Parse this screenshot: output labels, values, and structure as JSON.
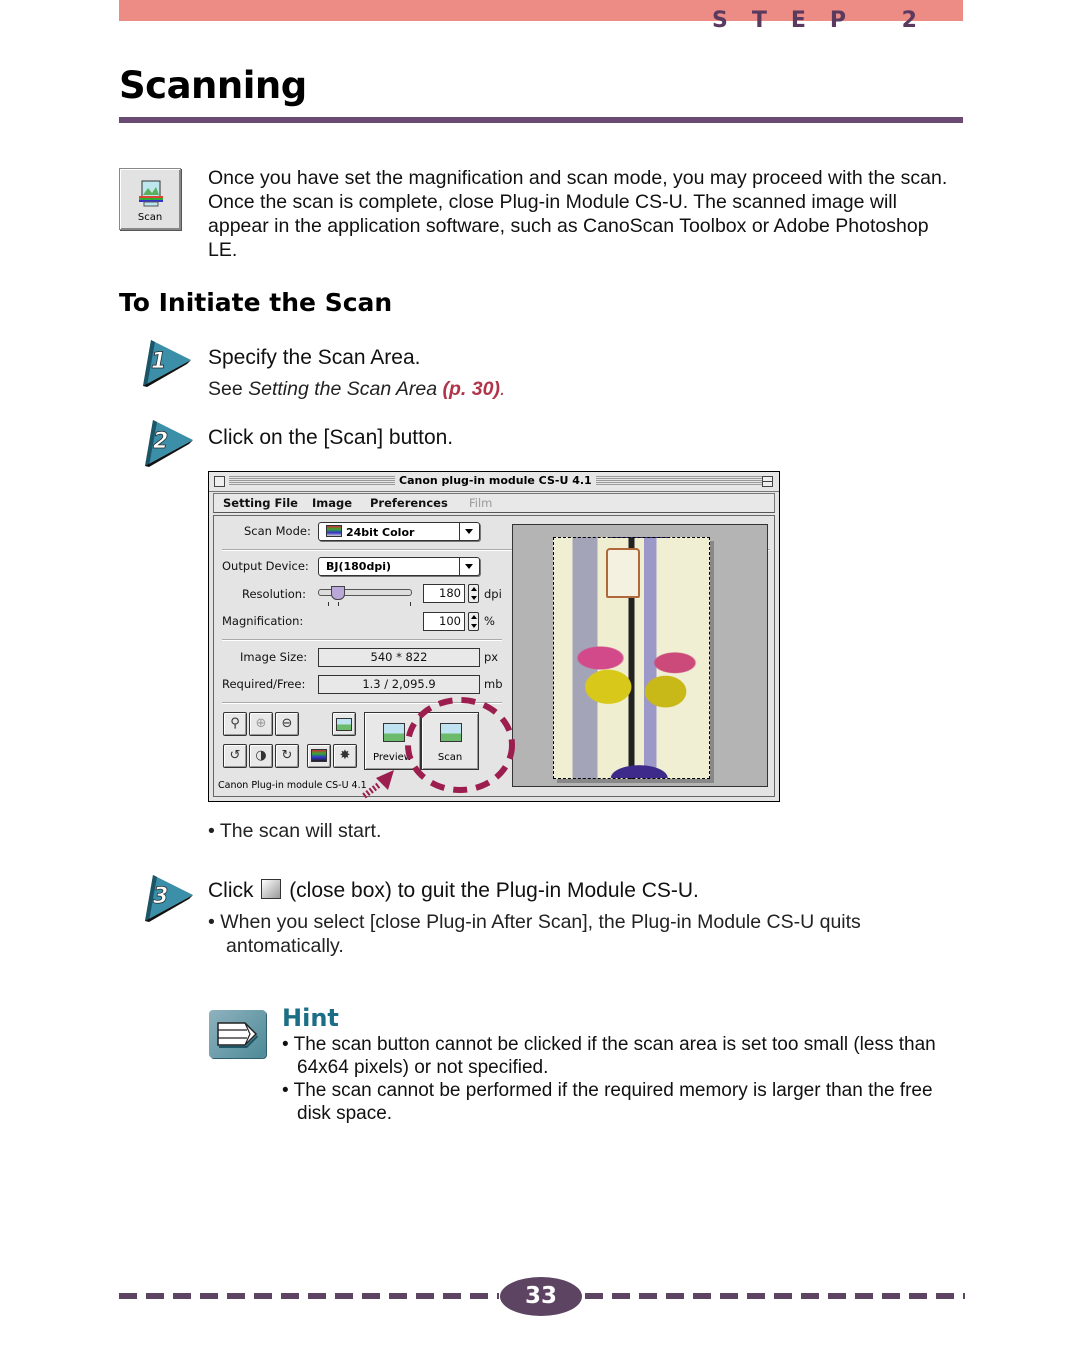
{
  "header": {
    "step_label": "STEP 2",
    "page_title": "Scanning"
  },
  "intro": {
    "icon_label": "Scan",
    "text": "Once you have set the magnification and scan mode, you may proceed with the scan. Once the scan is complete, close Plug-in Module CS-U. The scanned image will appear in the application software, such as CanoScan Toolbox or Adobe Photoshop LE."
  },
  "section": {
    "title": "To Initiate the Scan"
  },
  "steps": [
    {
      "number": "1",
      "text": "Specify the Scan Area.",
      "sub_prefix": "See ",
      "sub_italic": "Setting the Scan Area",
      "sub_link": "(p. 30)",
      "sub_suffix": "."
    },
    {
      "number": "2",
      "text": "Click on the [Scan] button.",
      "bullet": "• The scan will start."
    },
    {
      "number": "3",
      "text_before": "Click",
      "text_after": "(close box) to guit the Plug-in Module CS-U.",
      "bullet_line1": "• When you select [close Plug-in After Scan], the Plug-in Module CS-U quits",
      "bullet_line2": "antomatically."
    }
  ],
  "window": {
    "title": "Canon plug-in module CS-U 4.1",
    "menu": [
      "Setting File",
      "Image",
      "Preferences",
      "Film"
    ],
    "scan_mode_label": "Scan Mode:",
    "scan_mode_value": "24bit Color",
    "output_device_label": "Output Device:",
    "output_device_value": "BJ(180dpi)",
    "resolution_label": "Resolution:",
    "resolution_value": "180",
    "resolution_unit": "dpi",
    "magnification_label": "Magnification:",
    "magnification_value": "100",
    "magnification_unit": "%",
    "image_size_label": "Image Size:",
    "image_size_value": "540 * 822",
    "image_size_unit": "px",
    "required_free_label": "Required/Free:",
    "required_free_value": "1.3 / 2,095.9",
    "required_free_unit": "mb",
    "preview_button": "Preview",
    "scan_button": "Scan",
    "status": "Canon Plug-in module CS-U 4.1",
    "tool_icons": [
      "zoom-icon",
      "zoom-in-icon",
      "zoom-out-icon",
      "rotate-left-icon",
      "mirror-icon",
      "rotate-right-icon",
      "auto-tone-icon",
      "color-settings-icon",
      "eyedropper-icon"
    ]
  },
  "hint": {
    "title": "Hint",
    "items": [
      "• The scan button cannot be clicked if the scan area is set too small (less than 64x64 pixels) or not specified.",
      "• The scan cannot be performed if the required memory is larger than the free disk space."
    ]
  },
  "footer": {
    "page_number": "33"
  },
  "colors": {
    "band": "#ec8c84",
    "accent_purple": "#5d4462",
    "link_red": "#b0354a",
    "hint_teal": "#1b6e86",
    "highlight_dash": "#9c1e4e"
  }
}
